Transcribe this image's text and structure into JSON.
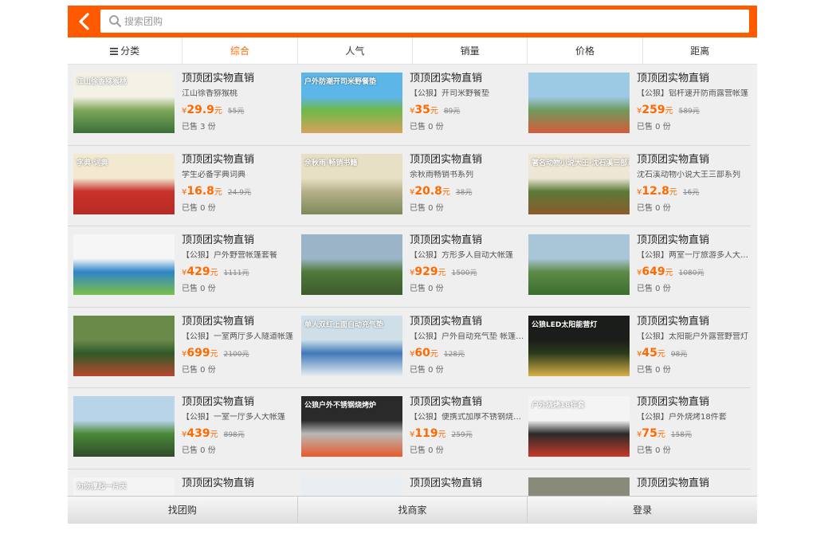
{
  "search": {
    "placeholder": "搜索团购"
  },
  "sort_bar": [
    "分类",
    "综合",
    "人气",
    "销量",
    "价格",
    "距离"
  ],
  "products": [
    {
      "caption": "江山徐香猕猴桃",
      "colors": [
        "#f4f1e6",
        "#7ea85a",
        "#3b6f3a"
      ],
      "title": "顶顶团实物直销",
      "desc": "江山徐香猕猴桃",
      "price": "29.9",
      "orig": "55元",
      "sold": "已售 3 份"
    },
    {
      "caption": "户外防潮开司米野餐垫",
      "colors": [
        "#5db6e8",
        "#6fb84a",
        "#d8a25c"
      ],
      "title": "顶顶团实物直销",
      "desc": "【公狼】开司米野餐垫",
      "price": "35",
      "orig": "89元",
      "sold": "已售 0 份"
    },
    {
      "caption": "",
      "colors": [
        "#9cc9e4",
        "#6f9a5d",
        "#d65a3a"
      ],
      "title": "顶顶团实物直销",
      "desc": "【公狼】铝杆速开防雨露营帐篷",
      "price": "259",
      "orig": "589元",
      "sold": "已售 0 份"
    },
    {
      "caption": "字典·词典",
      "colors": [
        "#f2e9d0",
        "#c8322a",
        "#b82a25"
      ],
      "title": "顶顶团实物直销",
      "desc": "学生必备字典词典",
      "price": "16.8",
      "orig": "24.9元",
      "sold": "已售 0 份"
    },
    {
      "caption": "余秋雨·畅销书籍",
      "colors": [
        "#e8e0c4",
        "#b8b08a",
        "#7c8a5a"
      ],
      "title": "顶顶团实物直销",
      "desc": "余秋雨畅销书系列",
      "price": "20.8",
      "orig": "38元",
      "sold": "已售 0 份"
    },
    {
      "caption": "著名动物小说大王·沈石溪三部系列",
      "colors": [
        "#efe7d5",
        "#5d7a3a",
        "#8a5a2a"
      ],
      "title": "顶顶团实物直销",
      "desc": "沈石溪动物小说大王三部系列",
      "price": "12.8",
      "orig": "16元",
      "sold": "已售 0 份"
    },
    {
      "caption": "",
      "colors": [
        "#f6f6f6",
        "#2f84c7",
        "#7cc04a"
      ],
      "title": "顶顶团实物直销",
      "desc": "【公狼】户外野营帐篷套餐",
      "price": "429",
      "orig": "1111元",
      "sold": "已售 0 份"
    },
    {
      "caption": "",
      "colors": [
        "#9bb4c8",
        "#4f7a3a",
        "#3f5a2e"
      ],
      "title": "顶顶团实物直销",
      "desc": "【公狼】方形多人自动大帐篷",
      "price": "929",
      "orig": "1500元",
      "sold": "已售 0 份"
    },
    {
      "caption": "",
      "colors": [
        "#a8c6d8",
        "#5f8a48",
        "#3a6e2f"
      ],
      "title": "顶顶团实物直销",
      "desc": "【公狼】两室一厅旅游多人大帐篷",
      "price": "649",
      "orig": "1080元",
      "sold": "已售 0 份"
    },
    {
      "caption": "",
      "colors": [
        "#6a8a4a",
        "#2f5a2a",
        "#b8472e"
      ],
      "title": "顶顶团实物直销",
      "desc": "【公狼】一室两厅多人隧道帐篷",
      "price": "699",
      "orig": "2100元",
      "sold": "已售 0 份"
    },
    {
      "caption": "单人双红上面自动充气垫",
      "colors": [
        "#cfdfe8",
        "#3f78b8",
        "#e8eef2"
      ],
      "title": "顶顶团实物直销",
      "desc": "【公狼】户外自动充气垫 帐篷睡垫",
      "price": "60",
      "orig": "128元",
      "sold": "已售 0 份"
    },
    {
      "caption": "公狼LED太阳能营灯",
      "colors": [
        "#1a1d1a",
        "#2a3a1a",
        "#d8b04a"
      ],
      "title": "顶顶团实物直销",
      "desc": "【公狼】太阳能户外露营野营灯",
      "price": "45",
      "orig": "98元",
      "sold": "已售 0 份"
    },
    {
      "caption": "",
      "colors": [
        "#b8d4e8",
        "#4a8a3a",
        "#2f4a2a"
      ],
      "title": "顶顶团实物直销",
      "desc": "【公狼】一室一厅多人大帐篷",
      "price": "439",
      "orig": "898元",
      "sold": "已售 0 份"
    },
    {
      "caption": "公狼户外不锈钢烧烤炉",
      "colors": [
        "#2a2a2a",
        "#b8b8b8",
        "#e85a2a"
      ],
      "title": "顶顶团实物直销",
      "desc": "【公狼】便携式加厚不锈钢烧烤炉",
      "price": "119",
      "orig": "259元",
      "sold": "已售 0 份"
    },
    {
      "caption": "户外烧烤18件套",
      "colors": [
        "#f4f4f4",
        "#2a2a2a",
        "#c83a2a"
      ],
      "title": "顶顶团实物直销",
      "desc": "【公狼】户外烧烤18件套",
      "price": "75",
      "orig": "158元",
      "sold": "已售 0 份"
    },
    {
      "caption": "为你撑起一片天",
      "colors": [
        "#f4f4f4",
        "#2f84c7",
        "#f2b24a"
      ],
      "title": "顶顶团实物直销",
      "desc": "",
      "price": "",
      "orig": "",
      "sold": ""
    },
    {
      "caption": "",
      "colors": [
        "#e8eef2",
        "#6aa8d8",
        "#ffffff"
      ],
      "title": "顶顶团实物直销",
      "desc": "",
      "price": "",
      "orig": "",
      "sold": ""
    },
    {
      "caption": "",
      "colors": [
        "#8a8a7a",
        "#5a5a4a",
        "#c8c8b8"
      ],
      "title": "顶顶团实物直销",
      "desc": "",
      "price": "",
      "orig": "",
      "sold": ""
    }
  ],
  "currency": "¥",
  "price_unit": "元",
  "footer": [
    "找团购",
    "找商家",
    "登录"
  ],
  "colors": {
    "brand": "#ff5a00",
    "accent": "#ff6a00"
  }
}
